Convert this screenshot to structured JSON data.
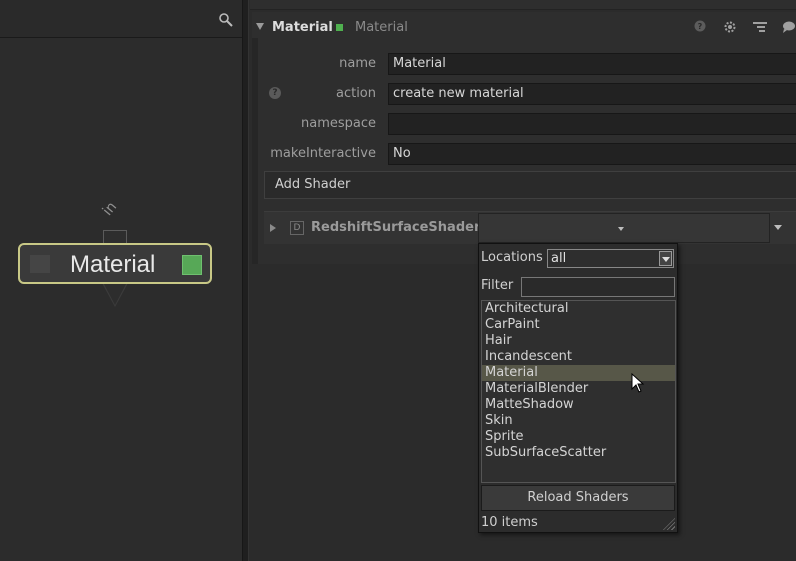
{
  "graph": {
    "node": {
      "label": "Material",
      "port_in_label": "in"
    }
  },
  "panel": {
    "section": {
      "title": "Material",
      "subtitle": "Material"
    },
    "rows": [
      {
        "label": "name",
        "value": "Material"
      },
      {
        "label": "action",
        "value": "create new material"
      },
      {
        "label": "namespace",
        "value": ""
      },
      {
        "label": "makeInteractive",
        "value": "No"
      }
    ],
    "add_shader_label": "Add Shader",
    "shader": {
      "name": "RedshiftSurfaceShader",
      "d_badge": "D"
    }
  },
  "popup": {
    "locations_label": "Locations",
    "locations_value": "all",
    "filter_label": "Filter",
    "filter_value": "",
    "items": [
      "Architectural",
      "CarPaint",
      "Hair",
      "Incandescent",
      "Material",
      "MaterialBlender",
      "MatteShadow",
      "Skin",
      "Sprite",
      "SubSurfaceScatter"
    ],
    "selected_item": "Material",
    "reload_label": "Reload Shaders",
    "count_label": "10 items"
  },
  "colors": {
    "node_border": "#c8c886",
    "node_swatch": "#57a857",
    "selection": "#575748"
  }
}
